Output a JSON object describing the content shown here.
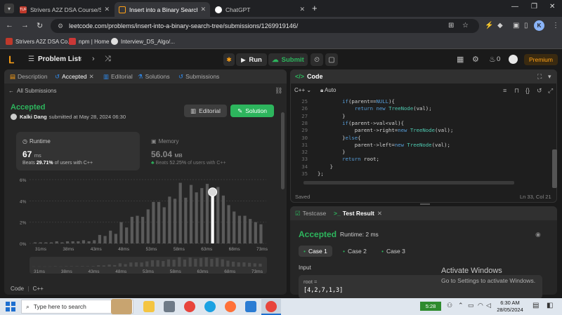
{
  "browser": {
    "tabs": [
      {
        "title": "Strivers A2Z DSA Course/Sheet",
        "favicon": "TUF",
        "active": false
      },
      {
        "title": "Insert into a Binary Search Tree",
        "favicon": "leetcode",
        "active": true
      },
      {
        "title": "ChatGPT",
        "favicon": "chatgpt",
        "active": false
      }
    ],
    "new_tab": "+",
    "url": "leetcode.com/problems/insert-into-a-binary-search-tree/submissions/1269919146/",
    "bookmarks": [
      {
        "label": "Strivers A2Z DSA Co..."
      },
      {
        "label": "npm | Home"
      },
      {
        "label": "Interview_DS_Algo/..."
      }
    ],
    "profile_initial": "K"
  },
  "header": {
    "problem_list": "Problem List",
    "run": "Run",
    "submit": "Submit",
    "streak": "0",
    "premium": "Premium"
  },
  "left": {
    "tabs": [
      "Description",
      "Accepted",
      "Editorial",
      "Solutions",
      "Submissions"
    ],
    "all_submissions": "All Submissions",
    "status": "Accepted",
    "submitter_name": "Kalki Dang",
    "submitted_at": "submitted at May 28, 2024 06:30",
    "editorial_btn": "Editorial",
    "solution_btn": "Solution",
    "runtime": {
      "label": "Runtime",
      "value": "67",
      "unit": "ms",
      "beats_prefix": "Beats",
      "beats": "29.71%",
      "beats_suffix": "of users with C++"
    },
    "memory": {
      "label": "Memory",
      "value": "56.04",
      "unit": "MB",
      "beats_prefix": "Beats",
      "beats": "52.25%",
      "beats_suffix": "of users with C++"
    },
    "code_label": "Code",
    "code_lang": "C++"
  },
  "chart_data": {
    "type": "bar",
    "ylabels": [
      "6%",
      "4%",
      "2%",
      "0%"
    ],
    "ylim": [
      0,
      6
    ],
    "xlabels": [
      "31ms",
      "38ms",
      "43ms",
      "48ms",
      "53ms",
      "58ms",
      "63ms",
      "68ms",
      "73ms"
    ],
    "values": [
      0.1,
      0.1,
      0.1,
      0.1,
      0.2,
      0.1,
      0.2,
      0.2,
      0.2,
      0.3,
      0.2,
      0.3,
      0.8,
      0.7,
      1.2,
      0.9,
      2.0,
      1.5,
      2.5,
      2.6,
      2.5,
      3.2,
      3.9,
      3.9,
      3.4,
      4.4,
      4.2,
      5.7,
      4.3,
      5.5,
      4.8,
      5.2,
      5.6,
      4.7,
      5.3,
      4.5,
      3.6,
      3.0,
      2.6,
      2.6,
      2.3,
      2.0,
      1.8
    ],
    "highlight_index": 33,
    "highlight_color": "#ffffff",
    "bar_color": "#5a5a5a"
  },
  "code": {
    "title": "Code",
    "lang": "C++",
    "mode": "Auto",
    "lines": [
      {
        "n": "25",
        "text": "        if(parent==NULL){"
      },
      {
        "n": "26",
        "text": "            return new TreeNode(val);"
      },
      {
        "n": "27",
        "text": "        }"
      },
      {
        "n": "28",
        "text": "        if(parent->val<val){"
      },
      {
        "n": "29",
        "text": "            parent->right=new TreeNode(val);"
      },
      {
        "n": "30",
        "text": "        }else{"
      },
      {
        "n": "31",
        "text": "            parent->left=new TreeNode(val);"
      },
      {
        "n": "32",
        "text": "        }"
      },
      {
        "n": "33",
        "text": "        return root;"
      },
      {
        "n": "34",
        "text": "    }"
      },
      {
        "n": "35",
        "text": "};"
      }
    ],
    "saved": "Saved",
    "position": "Ln 33, Col 21"
  },
  "test": {
    "testcase_tab": "Testcase",
    "result_tab": "Test Result",
    "status": "Accepted",
    "runtime": "Runtime: 2 ms",
    "cases": [
      "Case 1",
      "Case 2",
      "Case 3"
    ],
    "input_label": "Input",
    "root_label": "root =",
    "root_value": "[4,2,7,1,3]"
  },
  "watermark": {
    "line1": "Activate Windows",
    "line2": "Go to Settings to activate Windows."
  },
  "taskbar": {
    "search": "Type here to search",
    "battery": "5:28",
    "time": "6:30 AM",
    "date": "28/05/2024"
  }
}
